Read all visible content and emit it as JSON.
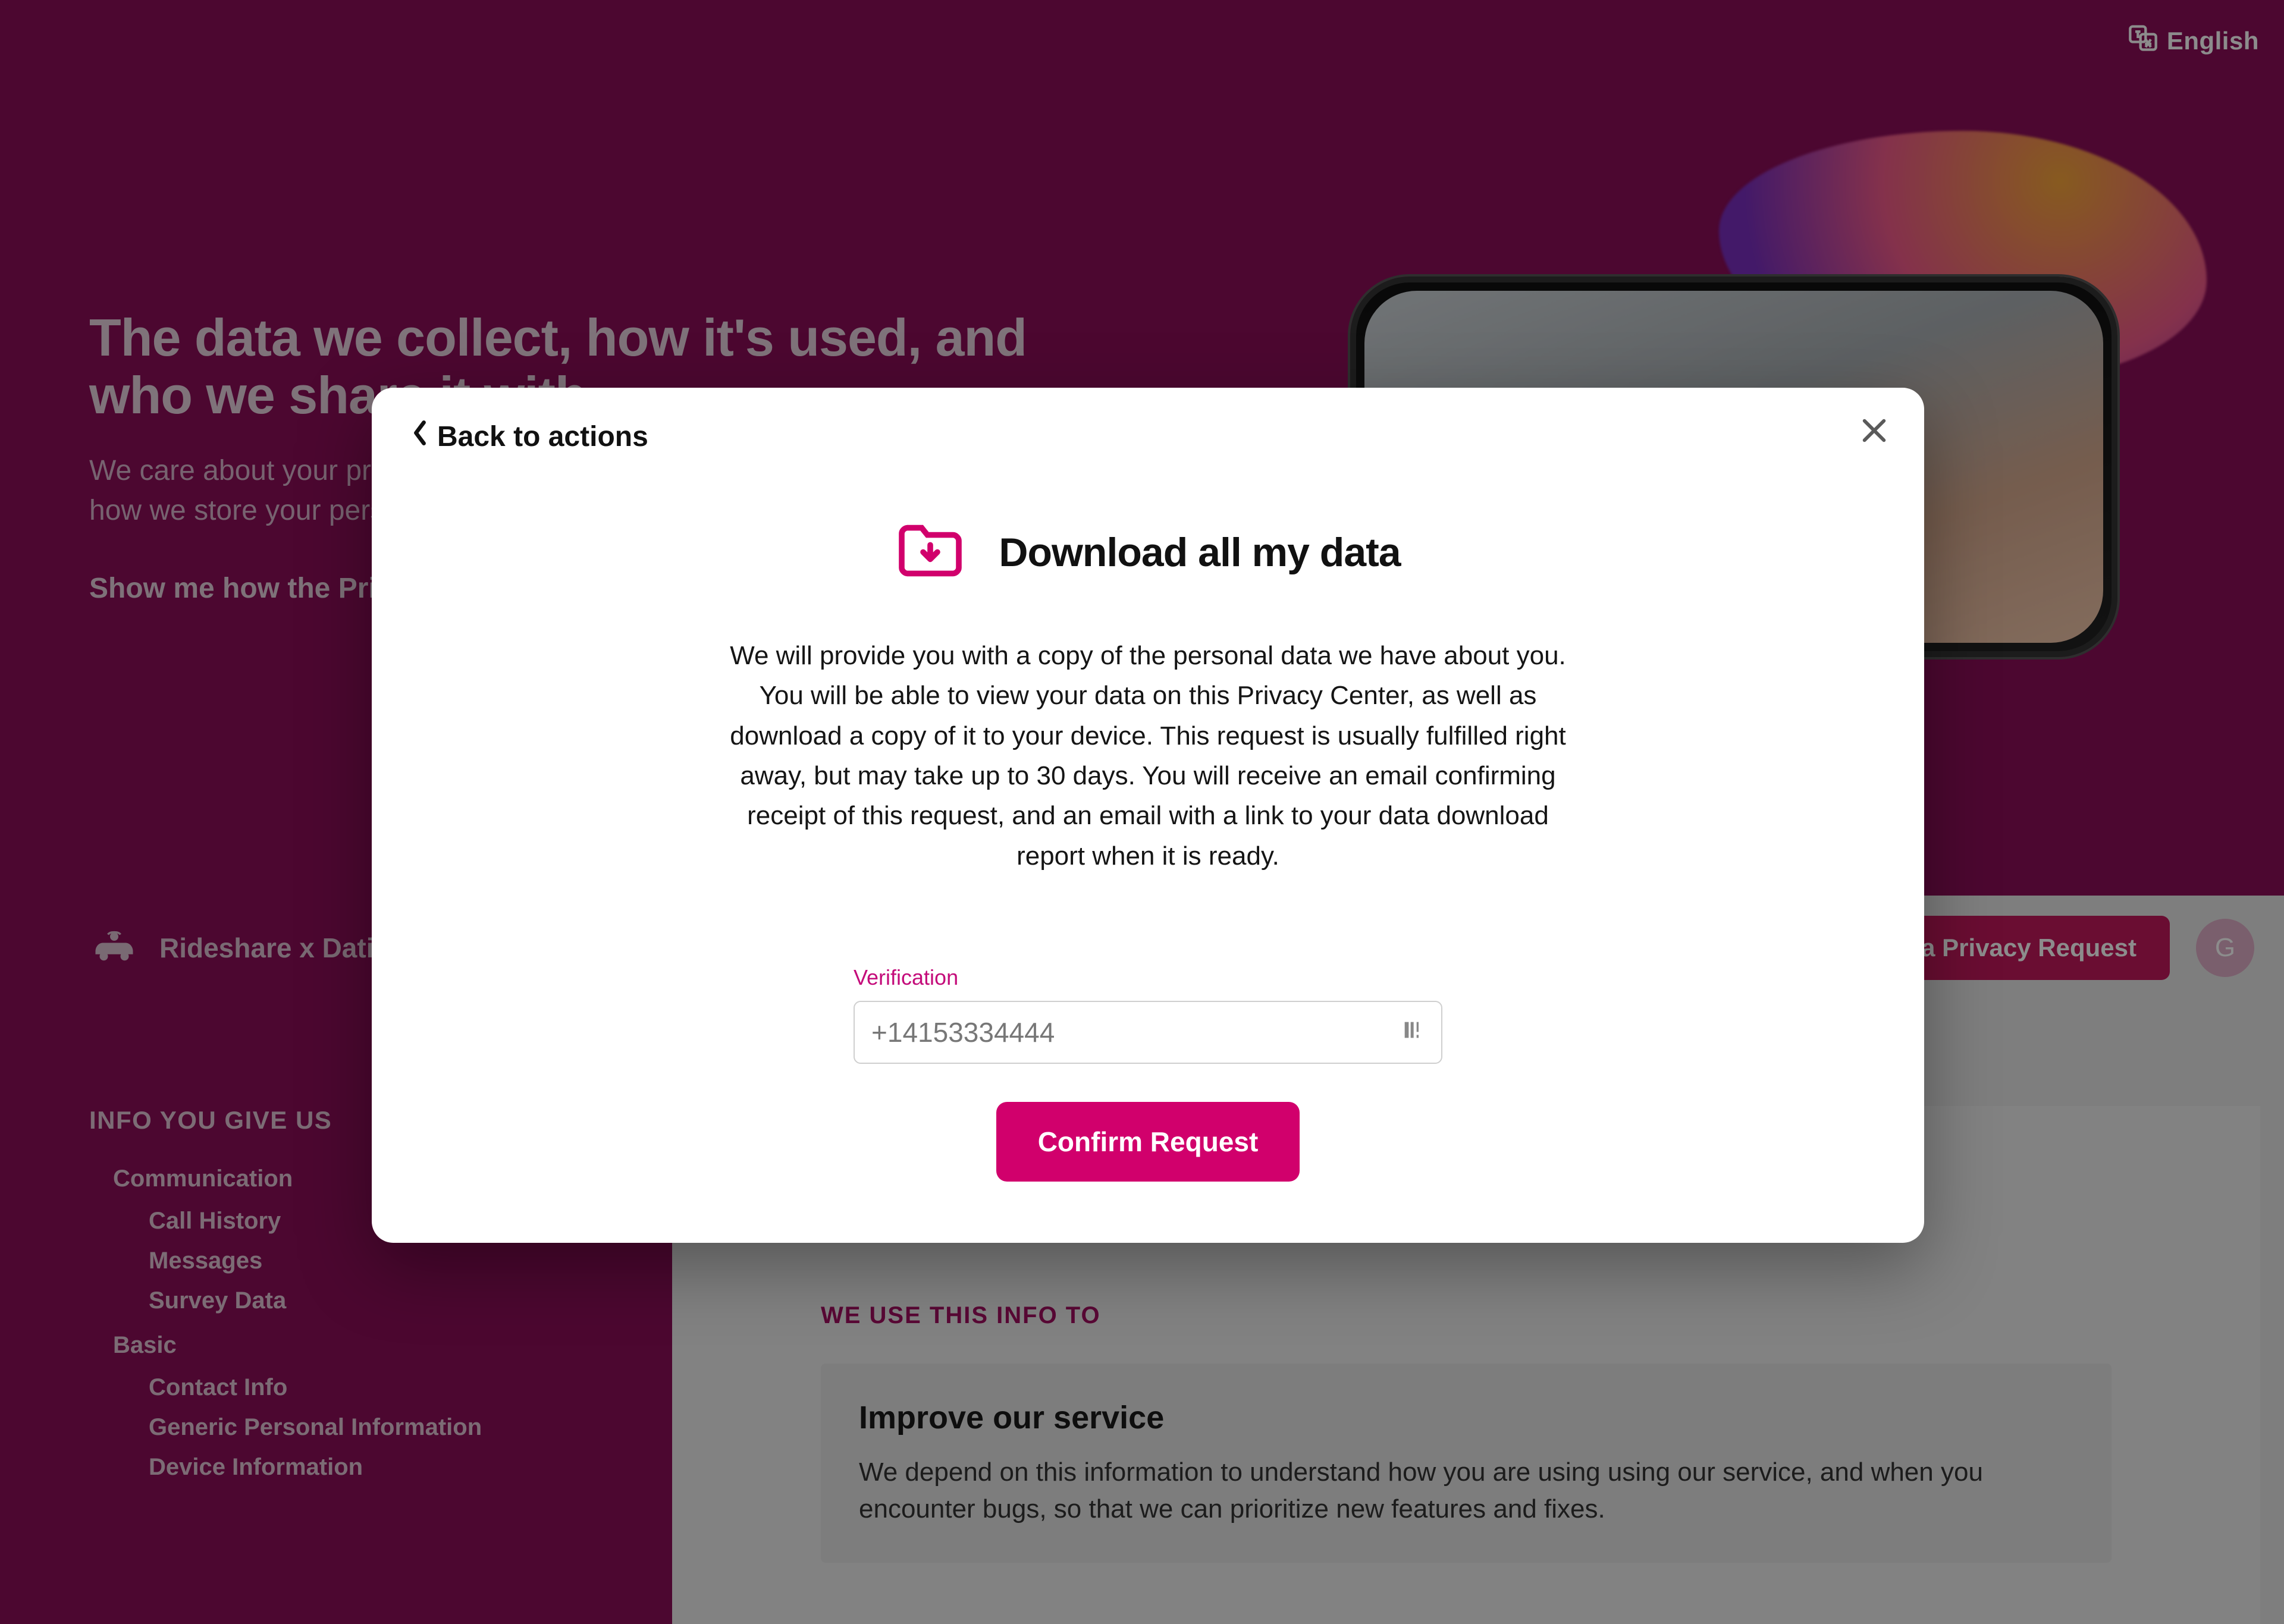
{
  "language": {
    "label": "English"
  },
  "hero": {
    "title": "The data we collect, how it's used, and who we share it with",
    "paragraph": "We care about your privacy and want to make it easy to find out more about how we store your personal information.",
    "show_link": "Show me how the Privacy Center works"
  },
  "brand": {
    "name": "Rideshare x Dating",
    "cta": "Make a Privacy Request",
    "avatar_initial": "G"
  },
  "sidebar": {
    "section": "INFO YOU GIVE US",
    "groups": [
      {
        "label": "Communication",
        "items": [
          "Call History",
          "Messages",
          "Survey Data"
        ]
      },
      {
        "label": "Basic",
        "items": [
          "Contact Info",
          "Generic Personal Information",
          "Device Information"
        ]
      }
    ]
  },
  "content": {
    "heading": "WE USE THIS INFO TO",
    "card": {
      "title": "Improve our service",
      "body": "We depend on this information to understand how you are using using our service, and when you encounter bugs, so that we can prioritize new features and fixes."
    }
  },
  "modal": {
    "back": "Back to actions",
    "title": "Download all my data",
    "body": "We will provide you with a copy of the personal data we have about you. You will be able to view your data on this Privacy Center, as well as download a copy of it to your device. This request is usually fulfilled right away, but may take up to 30 days. You will receive an email confirming receipt of this request, and an email with a link to your data download report when it is ready.",
    "verification_label": "Verification",
    "verification_placeholder": "+14153334444",
    "confirm": "Confirm Request"
  }
}
